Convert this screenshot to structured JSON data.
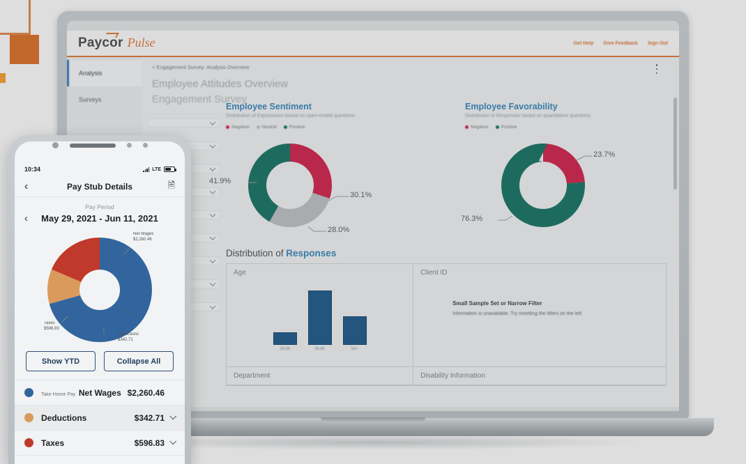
{
  "desktop": {
    "brand": {
      "name": "Paycor",
      "product": "Pulse"
    },
    "topbar_links": [
      "Get Help",
      "Give Feedback",
      "Sign Out"
    ],
    "nav": [
      {
        "label": "Analysis",
        "active": true
      },
      {
        "label": "Surveys",
        "active": false
      }
    ],
    "breadcrumb": "< Engagement Survey: Analysis Overview",
    "page_title": "Employee Attitudes Overview",
    "page_subtitle": "Engagement Survey",
    "kebab_menu": "more-options",
    "charts": [
      {
        "title": "Employee Sentiment",
        "subtitle": "Distribution of Expressions based on open-ended questions",
        "legend": [
          {
            "label": "Negative",
            "color": "#b9274a"
          },
          {
            "label": "Neutral",
            "color": "#a9acae"
          },
          {
            "label": "Positive",
            "color": "#1d6b5e"
          }
        ]
      },
      {
        "title": "Employee Favorability",
        "subtitle": "Distribution of Responses based on quantitative questions",
        "legend": [
          {
            "label": "Negative",
            "color": "#b9274a"
          },
          {
            "label": "Positive",
            "color": "#1d6b5e"
          }
        ]
      }
    ],
    "section_title_plain": "Distribution of ",
    "section_title_accent": "Responses",
    "panels": {
      "age_label": "Age",
      "client_id_label": "Client ID",
      "department_label": "Department",
      "disability_label": "Disability Information",
      "empty_title": "Small Sample Set or Narrow Filter",
      "empty_body": "Information is unavailable. Try resetting the filters on the left."
    },
    "filter_chips": 9
  },
  "phone": {
    "status": {
      "time": "10:34",
      "location_icon": "location-arrow-icon",
      "network": "LTE"
    },
    "navbar": {
      "back_icon": "chevron-left-icon",
      "title": "Pay Stub Details",
      "action_icon": "document-download-icon"
    },
    "pay_period": {
      "label": "Pay Period",
      "prev_icon": "chevron-left-icon",
      "range": "May 29, 2021 - Jun 11, 2021"
    },
    "donut_labels": {
      "net_wages_name": "Net Wages",
      "net_wages_value": "$2,260.46",
      "taxes_name": "Taxes",
      "taxes_value": "$596.83",
      "deductions_name": "Deductions",
      "deductions_value": "$342.71"
    },
    "buttons": {
      "show_ytd": "Show YTD",
      "collapse_all": "Collapse All"
    },
    "rows": [
      {
        "sub": "Take Home Pay",
        "name": "Net Wages",
        "amount": "$2,260.46",
        "color": "#32659e",
        "expandable": false
      },
      {
        "sub": "",
        "name": "Deductions",
        "amount": "$342.71",
        "color": "#d99a5b",
        "expandable": true
      },
      {
        "sub": "",
        "name": "Taxes",
        "amount": "$596.83",
        "color": "#c0392b",
        "expandable": true
      }
    ]
  },
  "chart_data": [
    {
      "type": "pie",
      "title": "Employee Sentiment",
      "subtitle": "Distribution of Expressions based on open-ended questions",
      "categories": [
        "Negative",
        "Neutral",
        "Positive"
      ],
      "values": [
        30.1,
        28.0,
        41.9
      ],
      "value_labels": [
        "30.1%",
        "28.0%",
        "41.9%"
      ],
      "colors": [
        "#b9274a",
        "#a9acae",
        "#1d6b5e"
      ],
      "donut": true,
      "legend_position": "top"
    },
    {
      "type": "pie",
      "title": "Employee Favorability",
      "subtitle": "Distribution of Responses based on quantitative questions",
      "categories": [
        "Negative",
        "Positive"
      ],
      "values": [
        23.7,
        76.3
      ],
      "value_labels": [
        "23.7%",
        "76.3%"
      ],
      "colors": [
        "#b9274a",
        "#1d6b5e"
      ],
      "donut": true,
      "legend_position": "top"
    },
    {
      "type": "bar",
      "title": "Age",
      "categories": [
        "18-34",
        "35-50",
        "51+"
      ],
      "values": [
        18,
        100,
        52
      ],
      "colors": [
        "#23557f",
        "#23557f",
        "#23557f"
      ],
      "xlabel": "",
      "ylabel": "",
      "grid": false
    },
    {
      "type": "pie",
      "title": "Pay Stub Details",
      "categories": [
        "Net Wages",
        "Taxes",
        "Deductions"
      ],
      "values": [
        2260.46,
        596.83,
        342.71
      ],
      "value_labels": [
        "$2,260.46",
        "$596.83",
        "$342.71"
      ],
      "colors": [
        "#32659e",
        "#c0392b",
        "#d99a5b"
      ],
      "donut": true,
      "legend_position": "bottom"
    }
  ]
}
